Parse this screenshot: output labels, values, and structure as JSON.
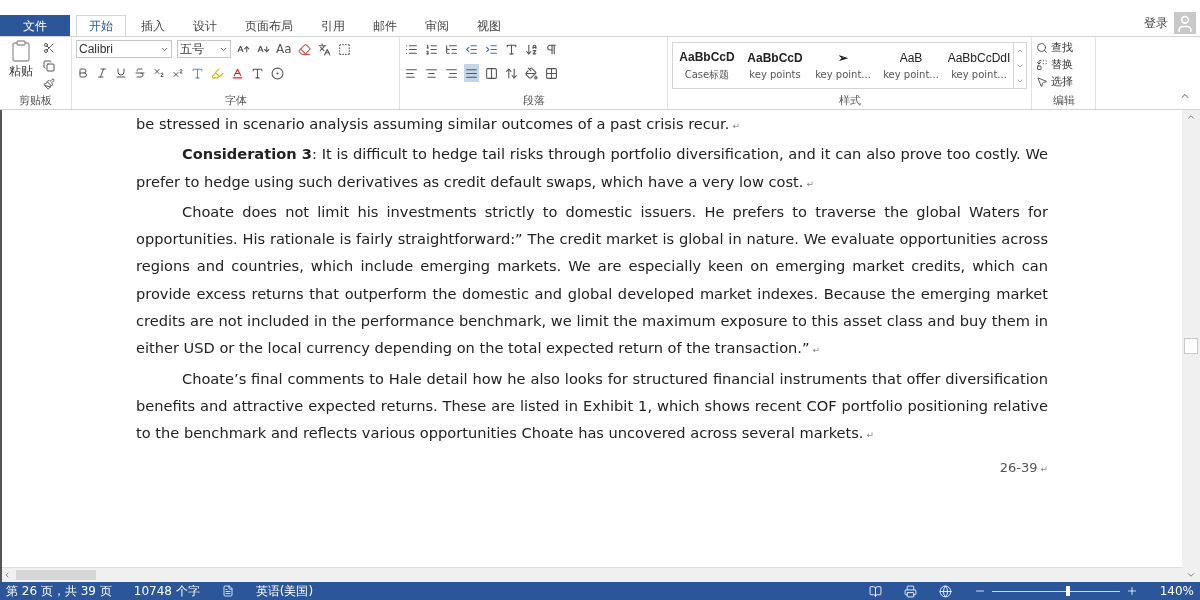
{
  "menu_tabs": [
    {
      "label": "文件",
      "kind": "file",
      "selected": false
    },
    {
      "label": "开始",
      "kind": "tab",
      "selected": true
    },
    {
      "label": "插入",
      "kind": "tab",
      "selected": false
    },
    {
      "label": "设计",
      "kind": "tab",
      "selected": false
    },
    {
      "label": "页面布局",
      "kind": "tab",
      "selected": false
    },
    {
      "label": "引用",
      "kind": "tab",
      "selected": false
    },
    {
      "label": "邮件",
      "kind": "tab",
      "selected": false
    },
    {
      "label": "审阅",
      "kind": "tab",
      "selected": false
    },
    {
      "label": "视图",
      "kind": "tab",
      "selected": false
    }
  ],
  "account": {
    "label": "登录"
  },
  "ribbon": {
    "clipboard": {
      "paste_label": "粘贴",
      "group_label": "剪贴板"
    },
    "font": {
      "font_name": "Calibri",
      "font_size": "五号",
      "case_label": "Aa",
      "group_label": "字体"
    },
    "paragraph": {
      "group_label": "段落"
    },
    "styles": {
      "items": [
        {
          "preview": "AaBbCcD",
          "name": "Case标题"
        },
        {
          "preview": "AaBbCcD",
          "name": "key points"
        },
        {
          "preview": "➢",
          "name": "key point..."
        },
        {
          "preview": "AaB",
          "name": "key point..."
        },
        {
          "preview": "AaBbCcDdI",
          "name": "key point..."
        }
      ],
      "group_label": "样式"
    },
    "editing": {
      "items": [
        {
          "label": "查找",
          "kind": "find"
        },
        {
          "label": "替换",
          "kind": "replace"
        },
        {
          "label": "选择",
          "kind": "select"
        }
      ],
      "group_label": "编辑"
    }
  },
  "document": {
    "paragraphs": [
      {
        "kind": "continuation",
        "text": "be stressed in scenario analysis assuming similar outcomes of a past crisis recur.",
        "mark": "↵"
      },
      {
        "kind": "body",
        "text": "**Consideration 3**: It is difficult to hedge tail risks through portfolio diversification, and it can also prove too costly. We prefer to hedge using such derivatives as credit default swaps, which have a very low cost.",
        "mark": "↵"
      },
      {
        "kind": "body",
        "text": "Choate does not limit his investments strictly to domestic issuers. He prefers to traverse the global Waters for opportunities. His rationale is fairly straightforward:” The credit market is global in nature. We evaluate opportunities across regions and countries, which include emerging markets. We are especially keen on emerging market credits, which can provide excess returns that outperform the domestic and global developed market indexes. Because the emerging market credits are not included in the performance benchmark, we limit the maximum exposure to this asset class and buy them in either USD or the local currency depending on the total expected return of the transaction.”",
        "mark": "↵"
      },
      {
        "kind": "body",
        "text": "Choate’s final comments to Hale detail how he also looks for structured financial instruments that offer diversification benefits and attractive expected returns. These are listed in Exhibit 1, which shows recent COF portfolio positioning relative to the benchmark and reflects various opportunities Choate has uncovered across several markets.",
        "mark": "↵"
      }
    ],
    "page_number": "26-39",
    "page_number_mark": "↵"
  },
  "status_bar": {
    "page": "第 26 页，共 39 页",
    "words": "10748 个字",
    "language": "英语(美国)",
    "zoom": "140%",
    "zoom_slider": {
      "level": 0.58
    }
  }
}
